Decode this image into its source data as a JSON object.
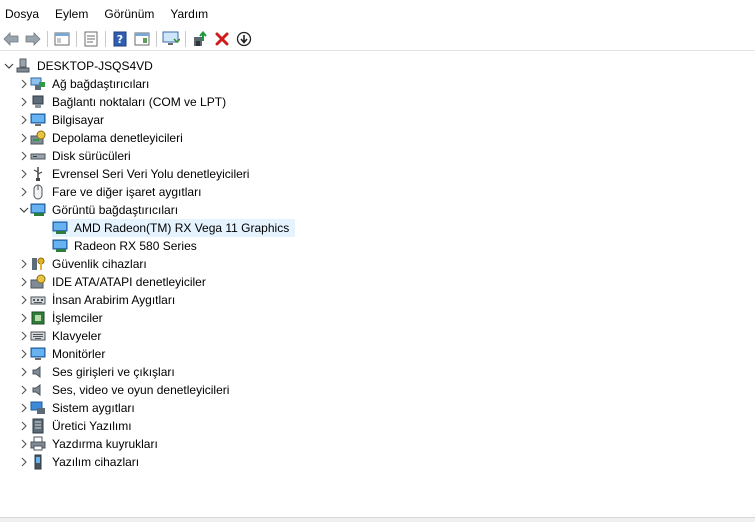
{
  "menu": {
    "items": [
      "Dosya",
      "Eylem",
      "Görünüm",
      "Yardım"
    ]
  },
  "toolbar": {
    "buttons": [
      "back-icon",
      "forward-icon",
      "sep",
      "console-tree-icon",
      "sep",
      "properties-icon",
      "sep",
      "help-icon",
      "action-pane-icon",
      "sep",
      "monitor-scan-icon",
      "sep",
      "update-driver-icon",
      "uninstall-icon",
      "disable-device-icon"
    ]
  },
  "tree": {
    "root": "DESKTOP-JSQS4VD",
    "categories": [
      {
        "label": "Ağ bağdaştırıcıları",
        "icon": "network-adapter-icon"
      },
      {
        "label": "Bağlantı noktaları (COM ve LPT)",
        "icon": "port-icon"
      },
      {
        "label": "Bilgisayar",
        "icon": "computer-icon"
      },
      {
        "label": "Depolama denetleyicileri",
        "icon": "storage-controller-icon"
      },
      {
        "label": "Disk sürücüleri",
        "icon": "disk-drive-icon"
      },
      {
        "label": "Evrensel Seri Veri Yolu denetleyicileri",
        "icon": "usb-icon"
      },
      {
        "label": "Fare ve diğer işaret aygıtları",
        "icon": "mouse-icon"
      },
      {
        "label": "Görüntü bağdaştırıcıları",
        "icon": "display-adapter-icon",
        "expanded": true,
        "children": [
          {
            "label": "AMD Radeon(TM) RX Vega 11 Graphics",
            "selected": true
          },
          {
            "label": "Radeon RX 580 Series"
          }
        ]
      },
      {
        "label": "Güvenlik cihazları",
        "icon": "security-key-icon"
      },
      {
        "label": "IDE ATA/ATAPI denetleyiciler",
        "icon": "ide-controller-icon"
      },
      {
        "label": "İnsan Arabirim Aygıtları",
        "icon": "hid-icon"
      },
      {
        "label": "İşlemciler",
        "icon": "processor-icon"
      },
      {
        "label": "Klavyeler",
        "icon": "keyboard-icon"
      },
      {
        "label": "Monitörler",
        "icon": "monitor-icon"
      },
      {
        "label": "Ses girişleri ve çıkışları",
        "icon": "speaker-icon"
      },
      {
        "label": "Ses, video ve oyun denetleyicileri",
        "icon": "speaker-icon"
      },
      {
        "label": "Sistem aygıtları",
        "icon": "system-device-icon"
      },
      {
        "label": "Üretici Yazılımı",
        "icon": "firmware-icon"
      },
      {
        "label": "Yazdırma kuyrukları",
        "icon": "printer-icon"
      },
      {
        "label": "Yazılım cihazları",
        "icon": "software-device-icon"
      }
    ]
  },
  "colors": {
    "selection": "#e5f3ff",
    "accent": "#1e6fc0"
  }
}
